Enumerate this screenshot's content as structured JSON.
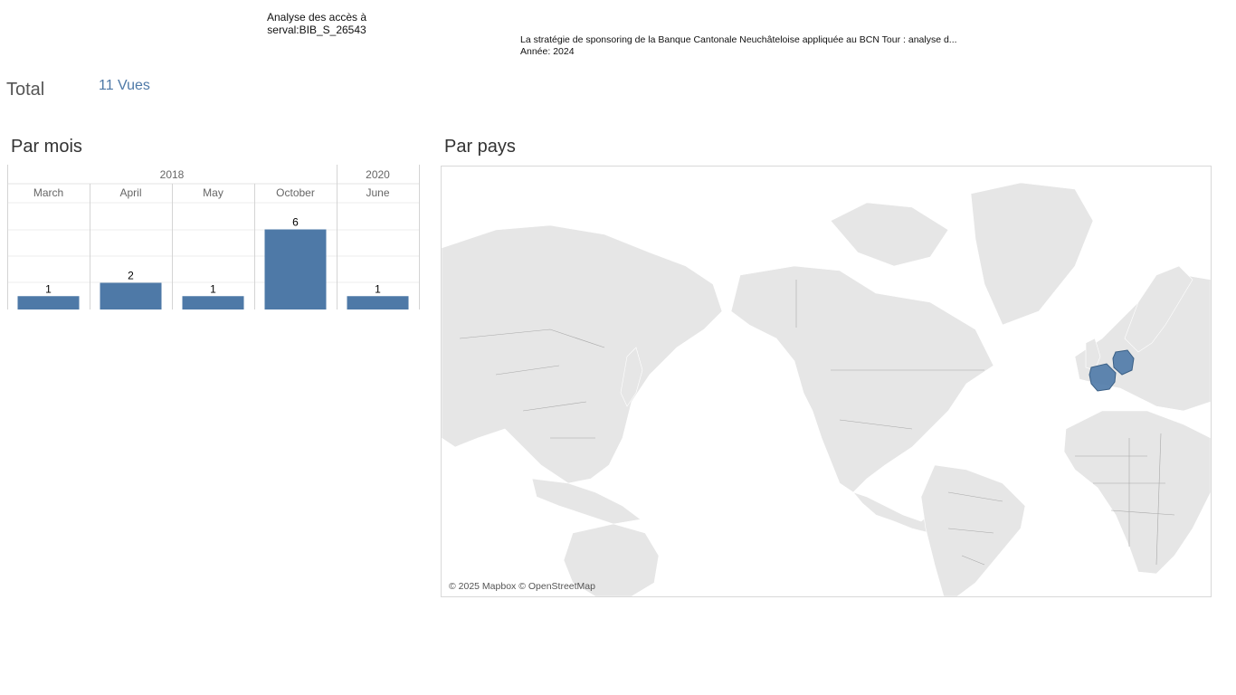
{
  "header": {
    "title_line1": "Analyse des accès à",
    "title_line2": "serval:BIB_S_26543"
  },
  "document": {
    "title": "La stratégie de sponsoring de la Banque Cantonale Neuchâteloise appliquée au BCN Tour : analyse d...",
    "year": "Année: 2024"
  },
  "total": {
    "label": "Total",
    "value": "11 Vues"
  },
  "sections": {
    "months": "Par mois",
    "countries": "Par pays"
  },
  "colors": {
    "accent": "#4e79a7",
    "land": "#e6e6e6",
    "border": "#a8a8a8"
  },
  "chart_data": {
    "type": "bar",
    "years": [
      {
        "year": "2018",
        "months": [
          "March",
          "April",
          "May",
          "October"
        ]
      },
      {
        "year": "2020",
        "months": [
          "June"
        ]
      }
    ],
    "categories": [
      "March",
      "April",
      "May",
      "October",
      "June"
    ],
    "values": [
      1,
      2,
      1,
      6,
      1
    ],
    "ylim": [
      0,
      8
    ],
    "grid": true
  },
  "map": {
    "highlighted_countries": [
      "France",
      "Germany"
    ],
    "attribution": "© 2025 Mapbox © OpenStreetMap"
  }
}
